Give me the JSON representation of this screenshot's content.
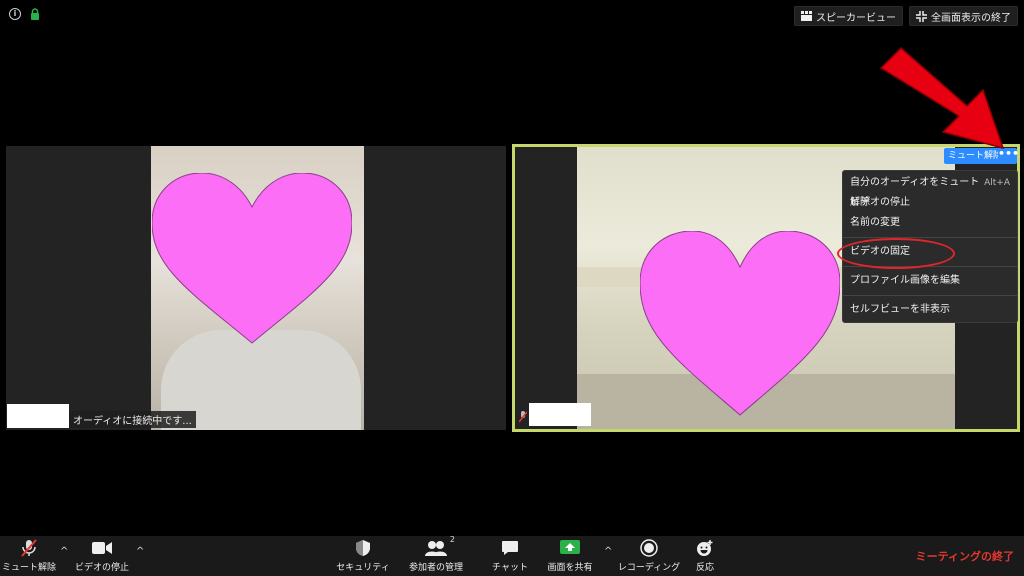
{
  "top_bar": {
    "speaker_view_label": "スピーカービュー",
    "exit_fullscreen_label": "全画面表示の終了"
  },
  "tile_left": {
    "status_text": "オーディオに接続中です..."
  },
  "tile_right": {
    "unmute_label": "ミュート解除",
    "more_label": "•••"
  },
  "context_menu": {
    "items": [
      {
        "label": "自分のオーディオをミュート解除",
        "shortcut": "Alt+A"
      },
      {
        "label": "ビデオの停止",
        "shortcut": ""
      },
      {
        "label": "名前の変更",
        "shortcut": ""
      },
      {
        "label": "ビデオの固定",
        "shortcut": ""
      },
      {
        "label": "プロファイル画像を編集",
        "shortcut": ""
      },
      {
        "label": "セルフビューを非表示",
        "shortcut": ""
      }
    ]
  },
  "toolbar": {
    "unmute_label": "ミュート解除",
    "stop_video_label": "ビデオの停止",
    "security_label": "セキュリティ",
    "participants_label": "参加者の管理",
    "participants_count": "2",
    "chat_label": "チャット",
    "share_label": "画面を共有",
    "record_label": "レコーディング",
    "reactions_label": "反応",
    "end_label": "ミーティングの終了"
  },
  "colors": {
    "accent_blue": "#2d8cff",
    "active_border": "#c6d86c",
    "end_red": "#e5372f",
    "annotation_red": "#e0262b",
    "share_green": "#2ab14b",
    "heart_pink": "#fb6ef5"
  },
  "icons": {
    "info": "info-icon",
    "lock": "lock-icon",
    "speaker_view": "speaker-view-icon",
    "exit_fullscreen": "exit-fullscreen-icon",
    "mic_muted": "mic-muted-icon",
    "video": "video-camera-icon",
    "security": "shield-icon",
    "participants": "participants-icon",
    "chat": "chat-bubble-icon",
    "share": "share-screen-icon",
    "record": "record-icon",
    "reactions": "emoji-icon"
  }
}
